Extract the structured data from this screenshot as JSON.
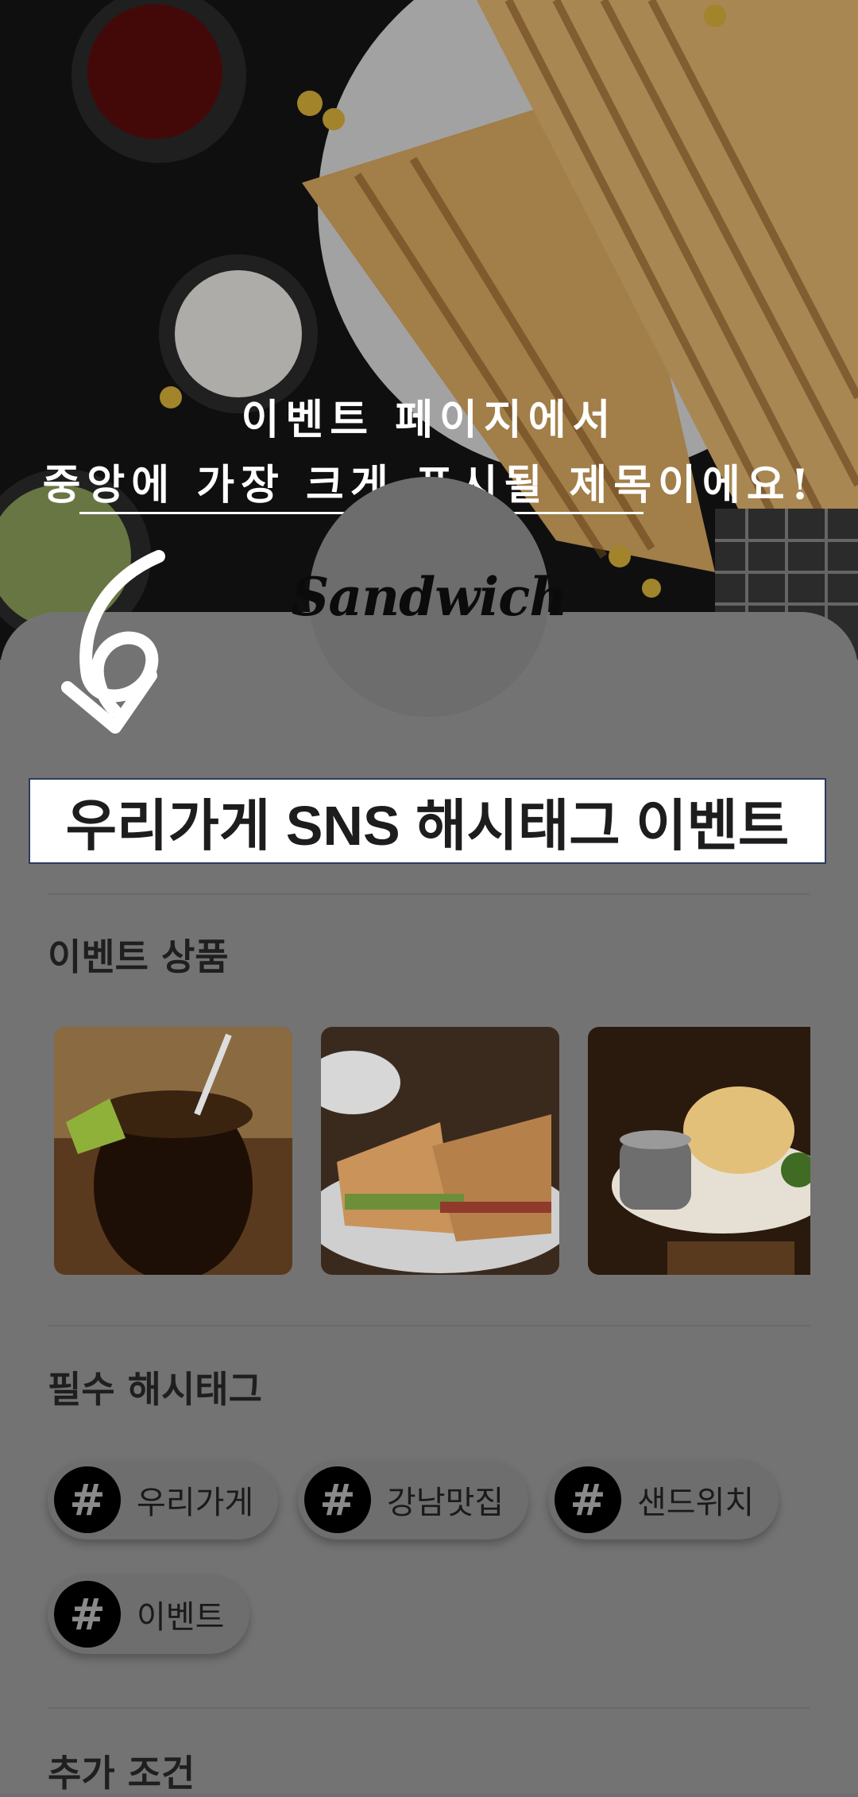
{
  "annotation": {
    "line1": "이벤트 페이지에서",
    "line2": "중앙에 가장 크게 표시될 제목이에요!"
  },
  "logo": {
    "text": "Sandwich"
  },
  "event": {
    "title": "우리가게 SNS 해시태그 이벤트"
  },
  "sections": {
    "products_title": "이벤트 상품",
    "hashtags_title": "필수 해시태그",
    "extra_title": "추가 조건"
  },
  "products": [
    {
      "name": "cola-drink-image"
    },
    {
      "name": "sandwich-image"
    },
    {
      "name": "bread-soup-image"
    }
  ],
  "hashtags": [
    {
      "icon": "hash-icon",
      "label": "우리가게"
    },
    {
      "icon": "hash-icon",
      "label": "강남맛집"
    },
    {
      "icon": "hash-icon",
      "label": "샌드위치"
    },
    {
      "icon": "hash-icon",
      "label": "이벤트"
    }
  ],
  "hashtag_symbol": "#",
  "colors": {
    "card": "#737373",
    "title_border": "#2b3a5e",
    "title_bg": "#ffffff"
  }
}
